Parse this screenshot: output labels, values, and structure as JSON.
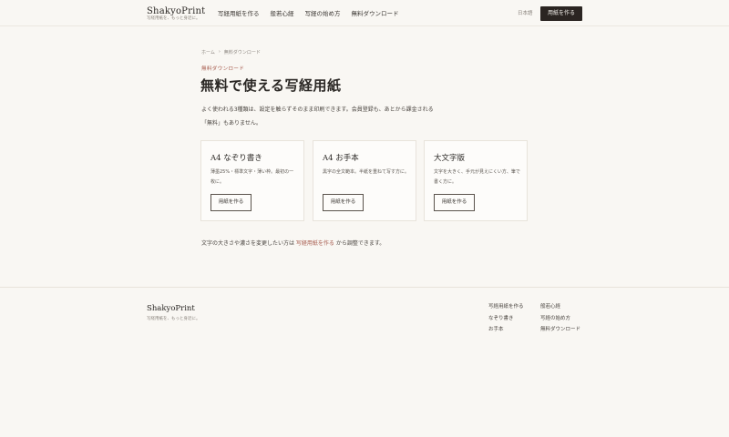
{
  "header": {
    "brand_name": "ShakyoPrint",
    "brand_tagline": "写経用紙を、もっと身近に。",
    "nav": [
      "写経用紙を作る",
      "般若心経",
      "写経の始め方",
      "無料ダウンロード"
    ],
    "language": "日本語",
    "cta": "用紙を作る"
  },
  "breadcrumb": {
    "home": "ホーム",
    "sep": "›",
    "current": "無料ダウンロード"
  },
  "main": {
    "eyebrow": "無料ダウンロード",
    "title": "無料で使える写経用紙",
    "lead_1": "よく使われる3種類は、設定を触らずそのまま印刷できます。会員登録も、あとから課金される",
    "lead_2": "「無料」もありません。"
  },
  "cards": [
    {
      "title": "A4 なぞり書き",
      "desc": "薄墨25%・標準文字・薄い枠。最初の一枚に。",
      "button": "用紙を作る"
    },
    {
      "title": "A4 お手本",
      "desc": "黒字の全文範本。半紙を重ねて写す方に。",
      "button": "用紙を作る"
    },
    {
      "title": "大文字版",
      "desc": "文字を大きく、手元が見えにくい方、筆で書く方に。",
      "button": "用紙を作る"
    }
  ],
  "note": {
    "before": "文字の大きさや濃さを変更したい方は ",
    "link": "写経用紙を作る",
    "after": " から調整できます。"
  },
  "footer": {
    "brand_name": "ShakyoPrint",
    "tagline": "写経用紙を、もっと身近に。",
    "col1": [
      "写経用紙を作る",
      "なぞり書き",
      "お手本"
    ],
    "col2": [
      "般若心経",
      "写経の始め方",
      "無料ダウンロード"
    ]
  }
}
